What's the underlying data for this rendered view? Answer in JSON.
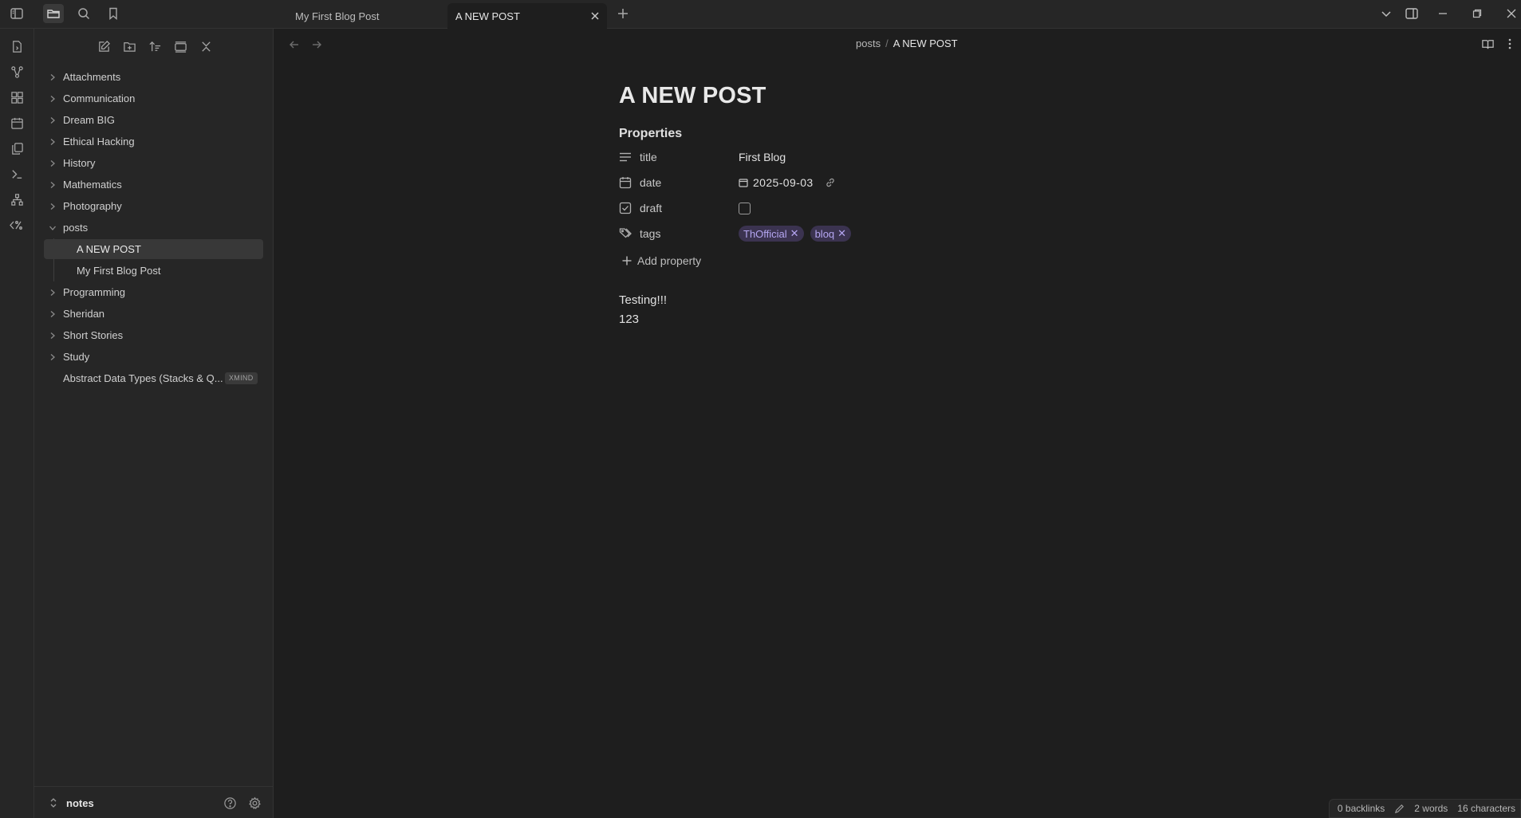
{
  "tabs": [
    {
      "label": "My First Blog Post",
      "active": false
    },
    {
      "label": "A NEW POST",
      "active": true
    }
  ],
  "breadcrumb": {
    "folder": "posts",
    "separator": "/",
    "current": "A NEW POST"
  },
  "tree": {
    "items": [
      {
        "label": "Attachments",
        "type": "folder"
      },
      {
        "label": "Communication",
        "type": "folder"
      },
      {
        "label": "Dream BIG",
        "type": "folder"
      },
      {
        "label": "Ethical Hacking",
        "type": "folder"
      },
      {
        "label": "History",
        "type": "folder"
      },
      {
        "label": "Mathematics",
        "type": "folder"
      },
      {
        "label": "Photography",
        "type": "folder"
      },
      {
        "label": "posts",
        "type": "folder-open"
      },
      {
        "label": "A NEW POST",
        "type": "file",
        "selected": true
      },
      {
        "label": "My First Blog Post",
        "type": "file"
      },
      {
        "label": "Programming",
        "type": "folder"
      },
      {
        "label": "Sheridan",
        "type": "folder"
      },
      {
        "label": "Short Stories",
        "type": "folder"
      },
      {
        "label": "Study",
        "type": "folder"
      },
      {
        "label": "Abstract Data Types (Stacks & Q...",
        "type": "file",
        "badge": "XMIND"
      }
    ]
  },
  "vault": {
    "name": "notes"
  },
  "document": {
    "title": "A NEW POST",
    "properties_heading": "Properties",
    "properties": {
      "title": {
        "key": "title",
        "value": "First Blog"
      },
      "date": {
        "key": "date",
        "value": "2025-09-03"
      },
      "draft": {
        "key": "draft",
        "checked": false
      },
      "tags": {
        "key": "tags",
        "values": [
          "ThOfficial",
          "bloq"
        ]
      }
    },
    "add_property_label": "Add property",
    "body_lines": [
      "Testing!!!",
      "123"
    ]
  },
  "status": {
    "backlinks": "0 backlinks",
    "words": "2 words",
    "characters": "16 characters"
  },
  "colors": {
    "accent_tag_bg": "#3b3350",
    "accent_tag_text": "#b5a6f2",
    "background": "#1e1e1e",
    "panel": "#262626"
  }
}
